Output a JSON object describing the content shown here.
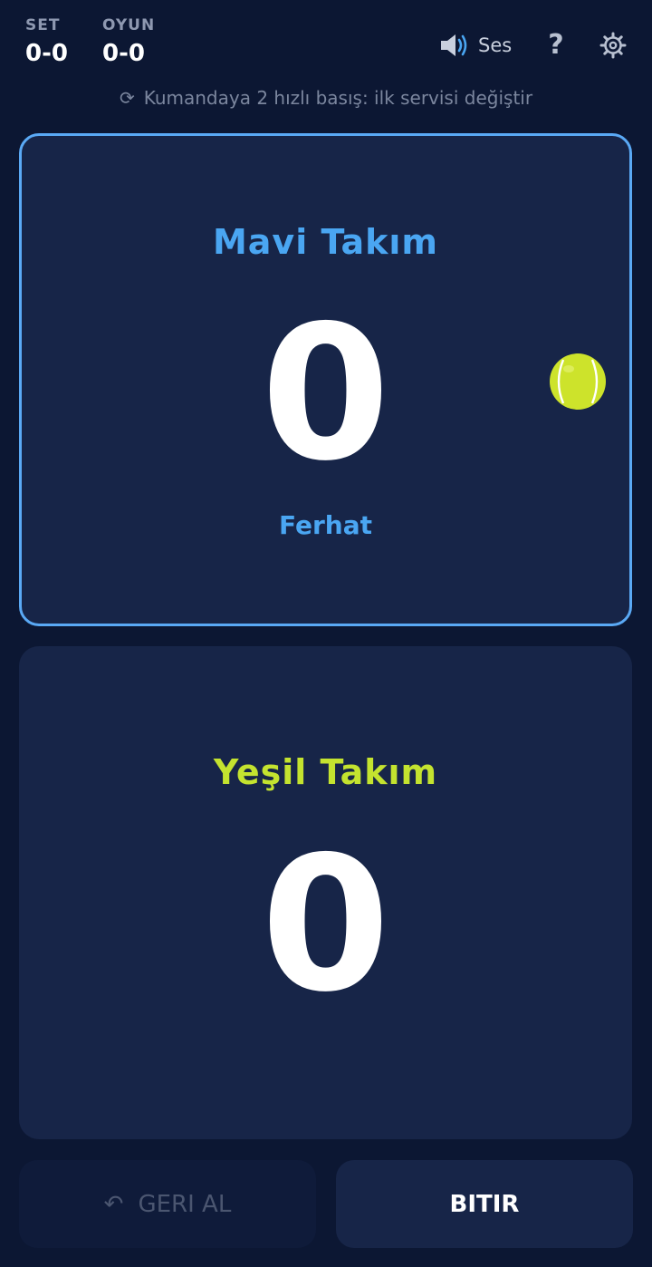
{
  "header": {
    "set": {
      "label": "SET",
      "value": "0-0"
    },
    "oyun": {
      "label": "OYUN",
      "value": "0-0"
    },
    "sound": {
      "label": "Ses",
      "icon": "speaker-icon"
    },
    "help": {
      "label": "?",
      "icon": "question-icon"
    },
    "settings": {
      "icon": "gear-icon"
    }
  },
  "hint": {
    "icon": "refresh-icon",
    "text": "Kumandaya 2 hızlı basış: ilk servisi değiştir"
  },
  "teams": [
    {
      "name": "Mavi Takım",
      "score": "0",
      "server": "Ferhat",
      "color": "#4aa6f2",
      "serving": true
    },
    {
      "name": "Yeşil Takım",
      "score": "0",
      "color": "#c4e32f",
      "serving": false
    }
  ],
  "actions": {
    "undo": {
      "label": "GERI AL",
      "icon": "undo-icon"
    },
    "finish": {
      "label": "BITIR"
    }
  },
  "colors": {
    "background": "#0c1733",
    "card": "#172548",
    "active_border": "#5aa9f5",
    "ball": "#cde32b"
  }
}
